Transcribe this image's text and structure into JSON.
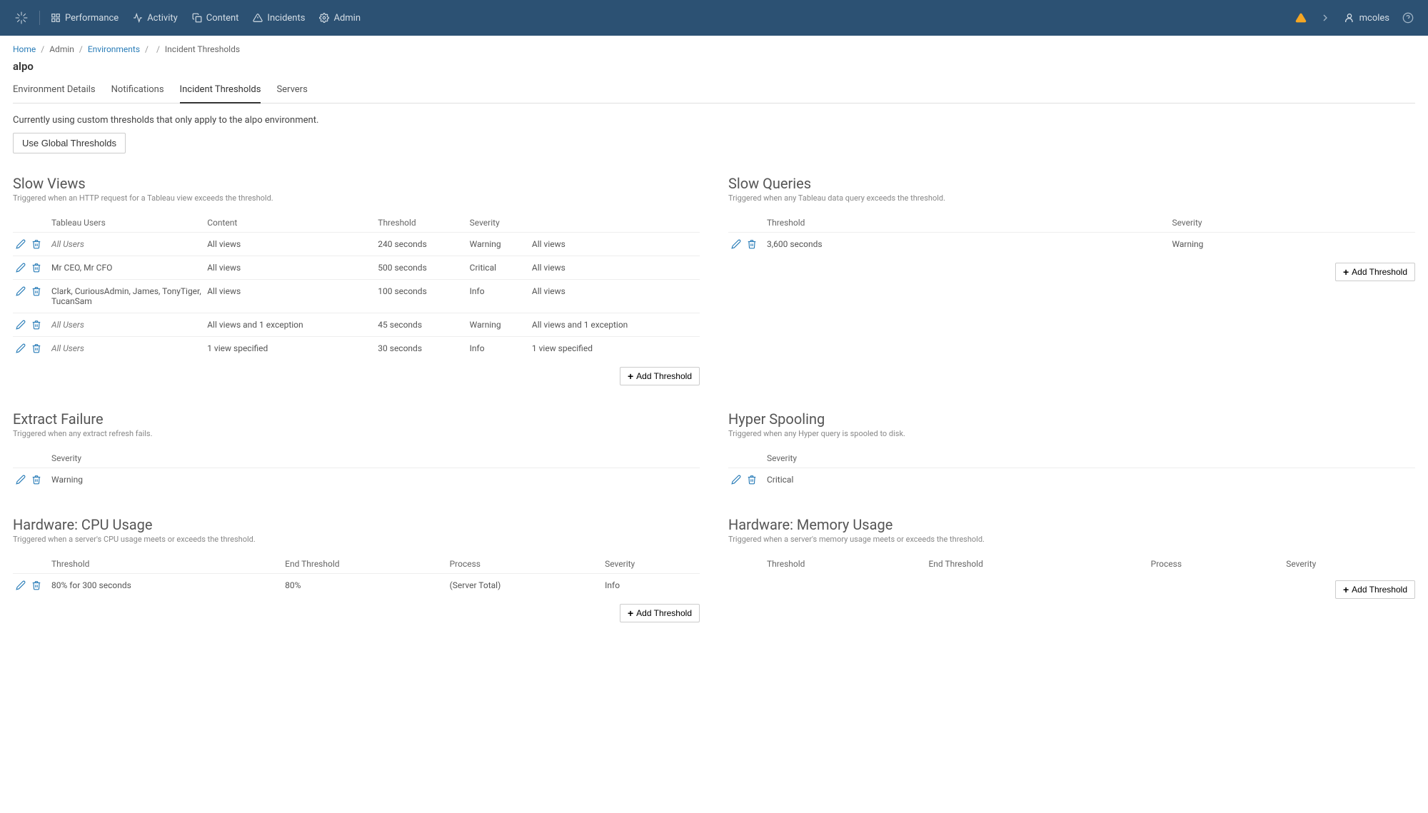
{
  "nav": {
    "items": [
      "Performance",
      "Activity",
      "Content",
      "Incidents",
      "Admin"
    ],
    "user": "mcoles"
  },
  "breadcrumb": {
    "home": "Home",
    "admin": "Admin",
    "environments": "Environments",
    "current": "Incident Thresholds"
  },
  "page": {
    "title": "alpo",
    "tabs": [
      "Environment Details",
      "Notifications",
      "Incident Thresholds",
      "Servers"
    ],
    "active_tab": "Incident Thresholds",
    "info": "Currently using custom thresholds that only apply to the alpo environment.",
    "global_btn": "Use Global Thresholds",
    "add_btn": "Add Threshold"
  },
  "slow_views": {
    "title": "Slow Views",
    "desc": "Triggered when an HTTP request for a Tableau view exceeds the threshold.",
    "headers": [
      "Tableau Users",
      "Content",
      "Threshold",
      "Severity",
      ""
    ],
    "rows": [
      {
        "users": "All Users",
        "users_italic": true,
        "content": "All views",
        "threshold": "240 seconds",
        "severity": "Warning",
        "extra": "All views"
      },
      {
        "users": "Mr CEO, Mr CFO",
        "users_italic": false,
        "content": "All views",
        "threshold": "500 seconds",
        "severity": "Critical",
        "extra": "All views"
      },
      {
        "users": "Clark, CuriousAdmin, James, TonyTiger, TucanSam",
        "users_italic": false,
        "content": "All views",
        "threshold": "100 seconds",
        "severity": "Info",
        "extra": "All views"
      },
      {
        "users": "All Users",
        "users_italic": true,
        "content": "All views and 1 exception",
        "threshold": "45 seconds",
        "severity": "Warning",
        "extra": "All views and 1 exception"
      },
      {
        "users": "All Users",
        "users_italic": true,
        "content": "1 view specified",
        "threshold": "30 seconds",
        "severity": "Info",
        "extra": "1 view specified"
      }
    ]
  },
  "slow_queries": {
    "title": "Slow Queries",
    "desc": "Triggered when any Tableau data query exceeds the threshold.",
    "headers": [
      "Threshold",
      "Severity"
    ],
    "rows": [
      {
        "threshold": "3,600 seconds",
        "severity": "Warning"
      }
    ]
  },
  "extract_failure": {
    "title": "Extract Failure",
    "desc": "Triggered when any extract refresh fails.",
    "headers": [
      "Severity"
    ],
    "rows": [
      {
        "severity": "Warning"
      }
    ]
  },
  "hyper_spooling": {
    "title": "Hyper Spooling",
    "desc": "Triggered when any Hyper query is spooled to disk.",
    "headers": [
      "Severity"
    ],
    "rows": [
      {
        "severity": "Critical"
      }
    ]
  },
  "cpu_usage": {
    "title": "Hardware: CPU Usage",
    "desc": "Triggered when a server's CPU usage meets or exceeds the threshold.",
    "headers": [
      "Threshold",
      "End Threshold",
      "Process",
      "Severity"
    ],
    "rows": [
      {
        "threshold": "80% for 300 seconds",
        "end": "80%",
        "process": "(Server Total)",
        "severity": "Info"
      }
    ]
  },
  "memory_usage": {
    "title": "Hardware: Memory Usage",
    "desc": "Triggered when a server's memory usage meets or exceeds the threshold.",
    "headers": [
      "Threshold",
      "End Threshold",
      "Process",
      "Severity"
    ],
    "rows": []
  }
}
